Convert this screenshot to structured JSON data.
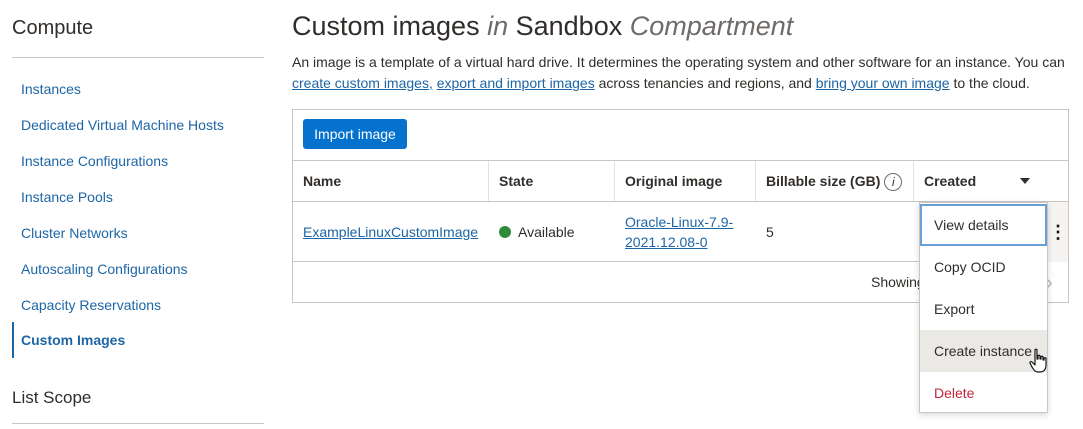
{
  "sidebar": {
    "title": "Compute",
    "items": [
      {
        "label": "Instances"
      },
      {
        "label": "Dedicated Virtual Machine Hosts"
      },
      {
        "label": "Instance Configurations"
      },
      {
        "label": "Instance Pools"
      },
      {
        "label": "Cluster Networks"
      },
      {
        "label": "Autoscaling Configurations"
      },
      {
        "label": "Capacity Reservations"
      },
      {
        "label": "Custom Images",
        "active": true
      }
    ],
    "scope_title": "List Scope"
  },
  "header": {
    "title_part1": "Custom images",
    "title_in": "in",
    "title_part2": "Sandbox",
    "title_part3": "Compartment"
  },
  "description": {
    "text1": "An image is a template of a virtual hard drive. It determines the operating system and other software for an instance. You can ",
    "link1": "create custom images,",
    "text2": " ",
    "link2": "export and import images",
    "text3": " across tenancies and regions, and ",
    "link3": "bring your own image",
    "text4": " to the cloud."
  },
  "toolbar": {
    "import_label": "Import image"
  },
  "table": {
    "columns": [
      "Name",
      "State",
      "Original image",
      "Billable size (GB)",
      "Created"
    ],
    "info_glyph": "i",
    "rows": [
      {
        "name": "ExampleLinuxCustomImage",
        "state": "Available",
        "original_image": "Oracle-Linux-7.9-2021.12.08-0",
        "billable_size": "5"
      }
    ],
    "kebab_glyph": "⋮",
    "footer_text": "Showing",
    "next_glyph": "›"
  },
  "menu": {
    "items": [
      "View details",
      "Copy OCID",
      "Export",
      "Create instance",
      "Delete"
    ]
  },
  "colors": {
    "accent": "#0572ce",
    "link": "#1d65a6",
    "available": "#2e8b3a",
    "danger": "#c0263a"
  }
}
